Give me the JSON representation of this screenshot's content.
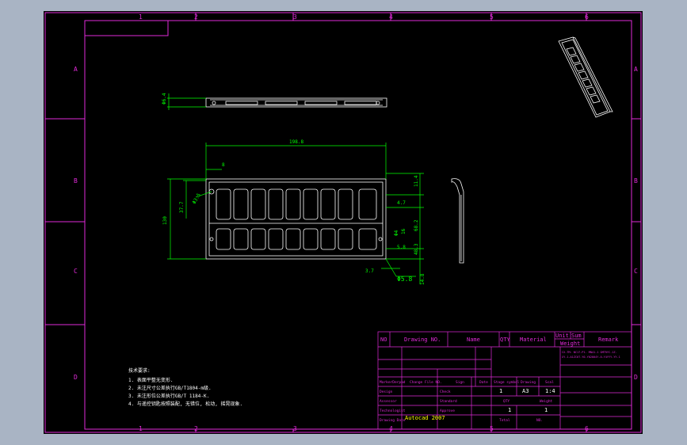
{
  "sheet": {
    "column_labels": [
      "1",
      "2",
      "3",
      "4",
      "5",
      "6"
    ],
    "row_labels": [
      "A",
      "B",
      "C",
      "D"
    ]
  },
  "views": {
    "top_view": {
      "dimension": "Φ6.4"
    },
    "front_view": {
      "dimensions": {
        "overall_width": "198.8",
        "overall_height": "130",
        "left_inset": "37.7",
        "left_small": "Φ3.5",
        "top_small": "8",
        "right_top": "11.4",
        "right_a": "4.7",
        "right_b": "16",
        "right_c": "Φ4",
        "right_d": "68.2",
        "right_e": "5.8",
        "right_f": "48.3",
        "bottom_left": "3.7",
        "bottom_hole": "Φ5.8",
        "bottom_right": "14.8"
      }
    }
  },
  "notes": {
    "title": "技术要求:",
    "items": [
      "1. 表面平整无变形.",
      "2. 未注尺寸公差执行GB/T1804-m级.",
      "3. 未注形位公差执行GB/T 1184-K.",
      "4. 与遥控钥匙按照装配, 无错位, 松动, 摇晃现象."
    ]
  },
  "title_block": {
    "header": [
      "NO",
      "Drawing NO.",
      "Name",
      "QTY",
      "Material",
      "Unit",
      "Sum",
      "Remark"
    ],
    "weight_label": "Weight",
    "small_text": [
      "CX-TM: NC17-P1. MN41-1 GMTRYC-1Z. ",
      "XY-1-A1ZC0T-Y0-Y02004Y-0-Y4YYY-YY-1"
    ],
    "rows": {
      "marker_label": "MarkerDerpad",
      "change_file_label": "Change File NO.",
      "sign_label": "Sign",
      "date_label": "Date",
      "stage_symbol_label": "Stage symbol",
      "drawing_label": "Drawing",
      "scale_label": "Scal",
      "design_label": "Design",
      "check_label": "Check",
      "assessor_label": "Assessor",
      "standard_label": "Standard",
      "technologist_label": "Technologist",
      "approve_label": "Approve",
      "drawing_date_label": "Drawing Date",
      "software": "Autocad 2007",
      "stage_value": "1",
      "drawing_value": "A3",
      "scale_value": "1:4",
      "qty_label": "QTY",
      "weight_label2": "Weight",
      "qty_value": "1",
      "weight_value": "1",
      "total_label": "Total",
      "no_label": "NO."
    }
  },
  "colors": {
    "frame": "#e02ad8",
    "object": "#ffffff",
    "dimension": "#00ff00",
    "text_yellow": "#ffff00",
    "background": "#000000"
  }
}
